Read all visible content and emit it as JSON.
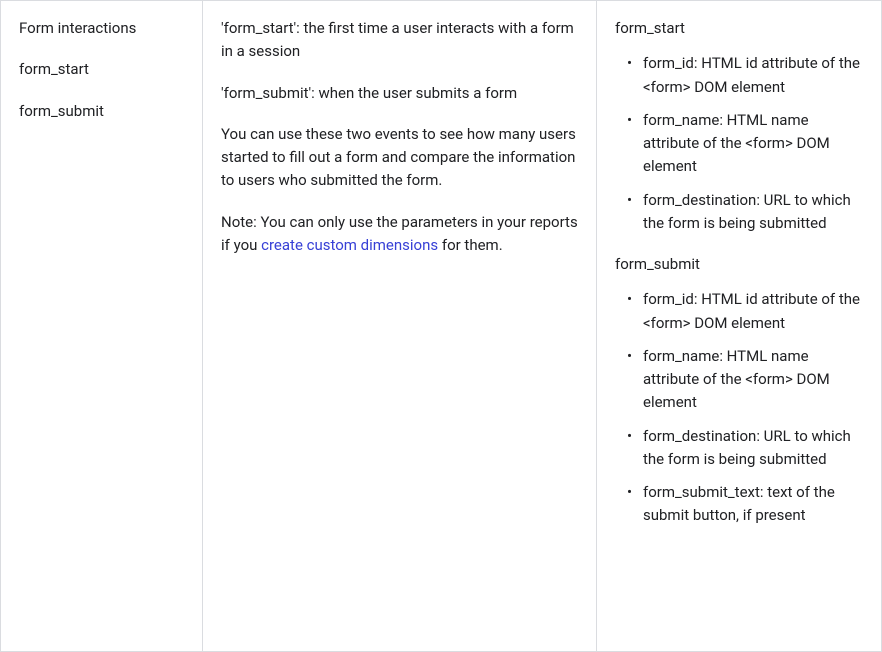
{
  "col1": {
    "title": "Form interactions",
    "event1": "form_start",
    "event2": "form_submit"
  },
  "col2": {
    "def1": "'form_start': the first time a user interacts with a form in a session",
    "def2": "'form_submit': when the user submits a form",
    "usage": "You can use these two events to see how many users started to fill out a form and compare the information to users who submitted the form.",
    "note_prefix": "Note: You can only use the parameters in your reports if you ",
    "note_link": "create custom dimensions",
    "note_suffix": " for them."
  },
  "col3": {
    "start": {
      "label": "form_start",
      "params": [
        "form_id: HTML id attribute of the <form> DOM element",
        "form_name: HTML name attribute of the <form> DOM element",
        "form_destination: URL to which the form is being submitted"
      ]
    },
    "submit": {
      "label": "form_submit",
      "params": [
        "form_id: HTML id attribute of the <form> DOM element",
        "form_name: HTML name attribute of the <form> DOM element",
        "form_destination: URL to which the form is being submitted",
        "form_submit_text: text of the submit button, if present"
      ]
    }
  }
}
